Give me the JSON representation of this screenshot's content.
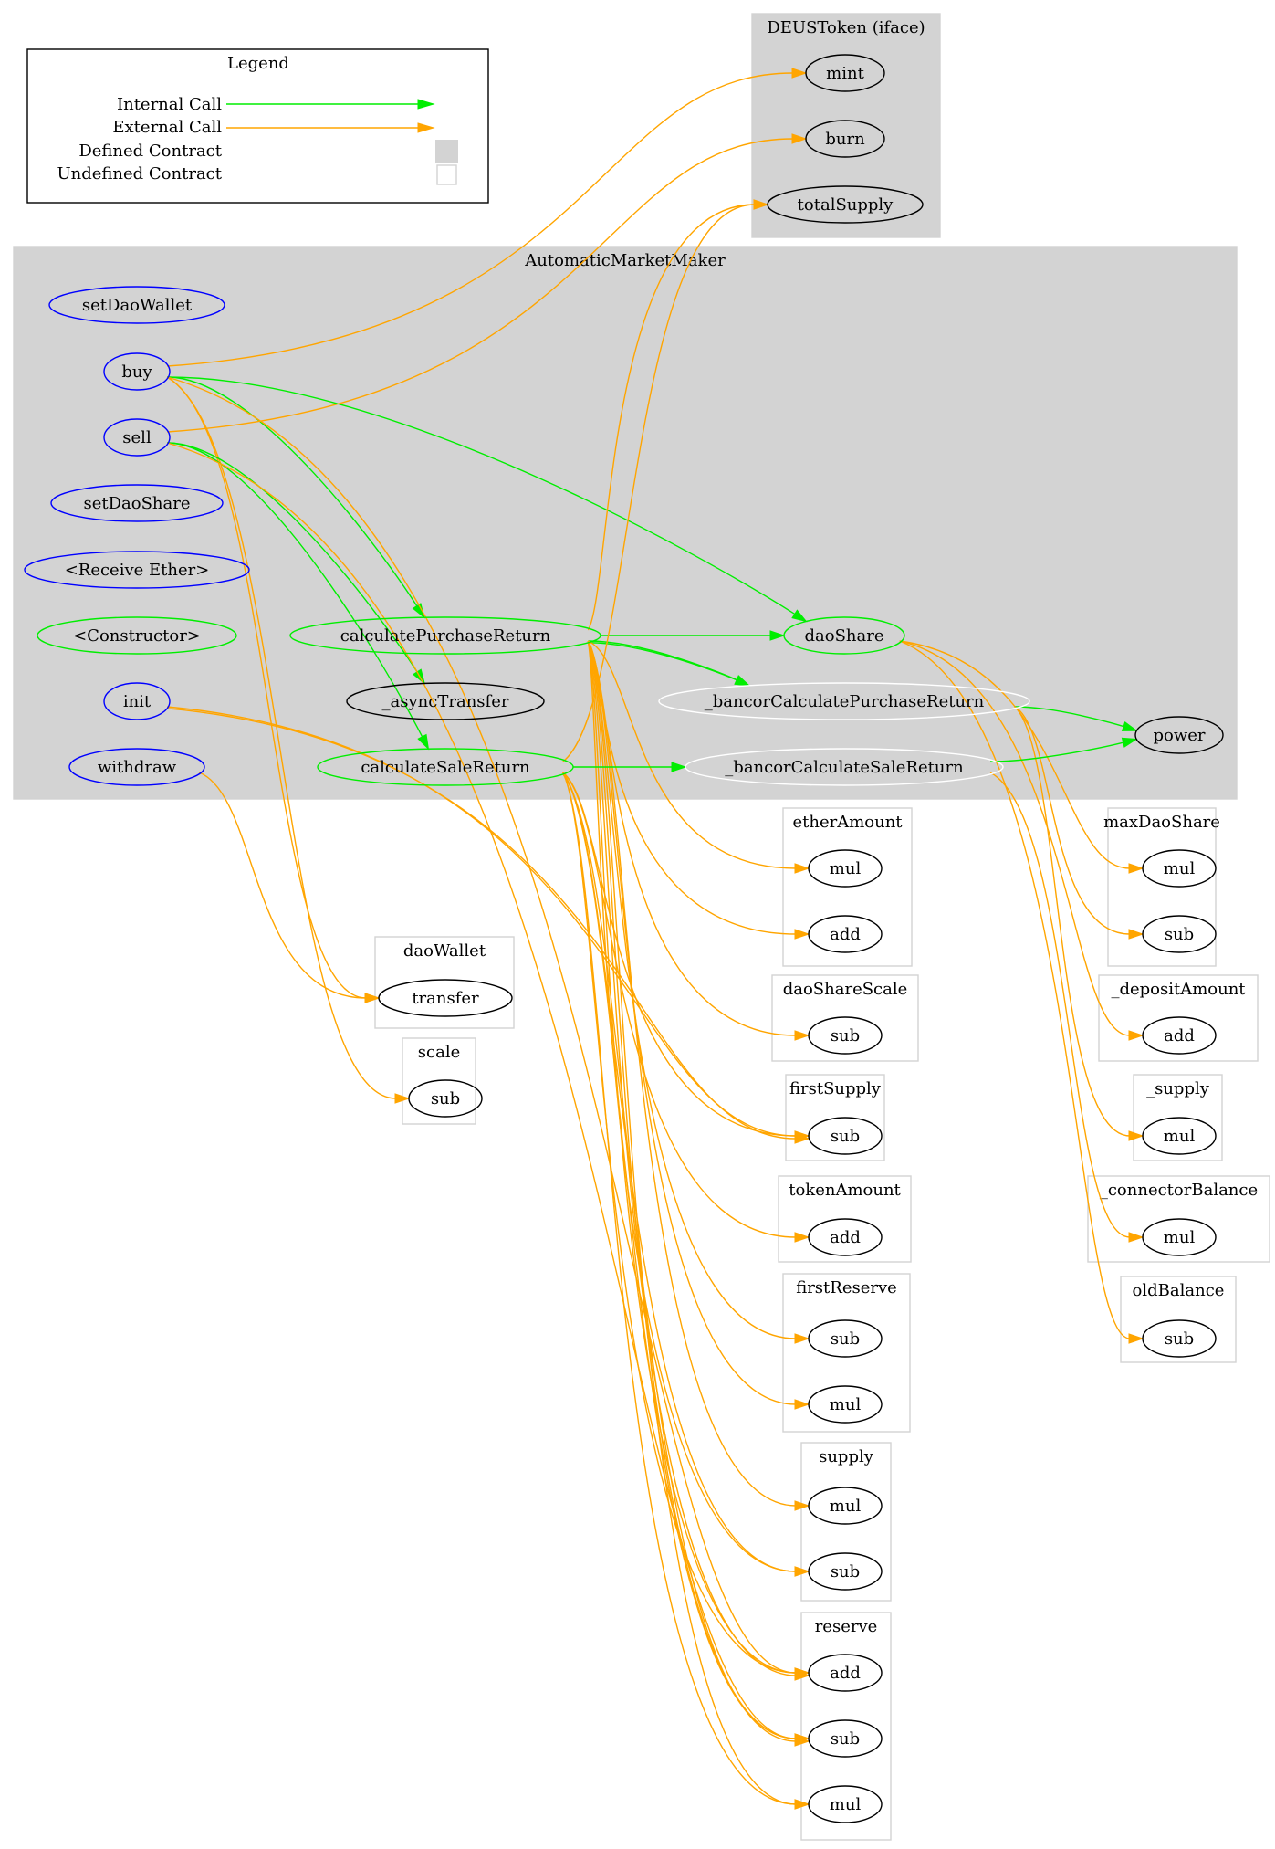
{
  "legend": {
    "title": "Legend",
    "items": [
      {
        "label": "Internal Call",
        "kind": "internal-edge"
      },
      {
        "label": "External Call",
        "kind": "external-edge"
      },
      {
        "label": "Defined Contract",
        "kind": "defined-box"
      },
      {
        "label": "Undefined Contract",
        "kind": "undefined-box"
      }
    ]
  },
  "colors": {
    "internal_call": "#00ee00",
    "external_call": "#ffa500",
    "defined_contract_fill": "#d3d3d3",
    "undefined_contract_border": "#d3d3d3",
    "public_function": "#0000ff",
    "internal_function": "#00ee00",
    "private_function": "#ffffff",
    "external_node": "#000000"
  },
  "clusters": [
    {
      "id": "DEUSToken",
      "label": "DEUSToken  (iface)",
      "defined": true
    },
    {
      "id": "AutomaticMarketMaker",
      "label": "AutomaticMarketMaker",
      "defined": true
    },
    {
      "id": "etherAmount",
      "label": "etherAmount",
      "defined": false
    },
    {
      "id": "maxDaoShare",
      "label": "maxDaoShare",
      "defined": false
    },
    {
      "id": "daoWallet",
      "label": "daoWallet",
      "defined": false
    },
    {
      "id": "daoShareScale",
      "label": "daoShareScale",
      "defined": false
    },
    {
      "id": "_depositAmount",
      "label": "_depositAmount",
      "defined": false
    },
    {
      "id": "scale",
      "label": "scale",
      "defined": false
    },
    {
      "id": "firstSupply",
      "label": "firstSupply",
      "defined": false
    },
    {
      "id": "_supply",
      "label": "_supply",
      "defined": false
    },
    {
      "id": "tokenAmount",
      "label": "tokenAmount",
      "defined": false
    },
    {
      "id": "_connectorBalance",
      "label": "_connectorBalance",
      "defined": false
    },
    {
      "id": "firstReserve",
      "label": "firstReserve",
      "defined": false
    },
    {
      "id": "oldBalance",
      "label": "oldBalance",
      "defined": false
    },
    {
      "id": "supply",
      "label": "supply",
      "defined": false
    },
    {
      "id": "reserve",
      "label": "reserve",
      "defined": false
    }
  ],
  "nodes": [
    {
      "id": "mint",
      "label": "mint",
      "cluster": "DEUSToken",
      "type": "external"
    },
    {
      "id": "burn",
      "label": "burn",
      "cluster": "DEUSToken",
      "type": "external"
    },
    {
      "id": "totalSupply",
      "label": "totalSupply",
      "cluster": "DEUSToken",
      "type": "external"
    },
    {
      "id": "setDaoWallet",
      "label": "setDaoWallet",
      "cluster": "AutomaticMarketMaker",
      "type": "public"
    },
    {
      "id": "buy",
      "label": "buy",
      "cluster": "AutomaticMarketMaker",
      "type": "public"
    },
    {
      "id": "sell",
      "label": "sell",
      "cluster": "AutomaticMarketMaker",
      "type": "public"
    },
    {
      "id": "setDaoShare",
      "label": "setDaoShare",
      "cluster": "AutomaticMarketMaker",
      "type": "public"
    },
    {
      "id": "receiveEther",
      "label": "<Receive Ether>",
      "cluster": "AutomaticMarketMaker",
      "type": "public"
    },
    {
      "id": "constructor",
      "label": "<Constructor>",
      "cluster": "AutomaticMarketMaker",
      "type": "internal"
    },
    {
      "id": "init",
      "label": "init",
      "cluster": "AutomaticMarketMaker",
      "type": "public"
    },
    {
      "id": "withdraw",
      "label": "withdraw",
      "cluster": "AutomaticMarketMaker",
      "type": "public"
    },
    {
      "id": "calculatePurchaseReturn",
      "label": "calculatePurchaseReturn",
      "cluster": "AutomaticMarketMaker",
      "type": "internal"
    },
    {
      "id": "asyncTransfer",
      "label": "_asyncTransfer",
      "cluster": "AutomaticMarketMaker",
      "type": "external"
    },
    {
      "id": "calculateSaleReturn",
      "label": "calculateSaleReturn",
      "cluster": "AutomaticMarketMaker",
      "type": "internal"
    },
    {
      "id": "daoShare",
      "label": "daoShare",
      "cluster": "AutomaticMarketMaker",
      "type": "internal"
    },
    {
      "id": "bancorPurchase",
      "label": "_bancorCalculatePurchaseReturn",
      "cluster": "AutomaticMarketMaker",
      "type": "private"
    },
    {
      "id": "bancorSale",
      "label": "_bancorCalculateSaleReturn",
      "cluster": "AutomaticMarketMaker",
      "type": "private"
    },
    {
      "id": "power",
      "label": "power",
      "cluster": "AutomaticMarketMaker",
      "type": "external"
    },
    {
      "id": "etherAmount_mul",
      "label": "mul",
      "cluster": "etherAmount",
      "type": "external"
    },
    {
      "id": "etherAmount_add",
      "label": "add",
      "cluster": "etherAmount",
      "type": "external"
    },
    {
      "id": "maxDaoShare_mul",
      "label": "mul",
      "cluster": "maxDaoShare",
      "type": "external"
    },
    {
      "id": "maxDaoShare_sub",
      "label": "sub",
      "cluster": "maxDaoShare",
      "type": "external"
    },
    {
      "id": "daoWallet_transfer",
      "label": "transfer",
      "cluster": "daoWallet",
      "type": "external"
    },
    {
      "id": "daoShareScale_sub",
      "label": "sub",
      "cluster": "daoShareScale",
      "type": "external"
    },
    {
      "id": "depositAmount_add",
      "label": "add",
      "cluster": "_depositAmount",
      "type": "external"
    },
    {
      "id": "scale_sub",
      "label": "sub",
      "cluster": "scale",
      "type": "external"
    },
    {
      "id": "firstSupply_sub",
      "label": "sub",
      "cluster": "firstSupply",
      "type": "external"
    },
    {
      "id": "_supply_mul",
      "label": "mul",
      "cluster": "_supply",
      "type": "external"
    },
    {
      "id": "tokenAmount_add",
      "label": "add",
      "cluster": "tokenAmount",
      "type": "external"
    },
    {
      "id": "connectorBalance_mul",
      "label": "mul",
      "cluster": "_connectorBalance",
      "type": "external"
    },
    {
      "id": "firstReserve_sub",
      "label": "sub",
      "cluster": "firstReserve",
      "type": "external"
    },
    {
      "id": "firstReserve_mul",
      "label": "mul",
      "cluster": "firstReserve",
      "type": "external"
    },
    {
      "id": "oldBalance_sub",
      "label": "sub",
      "cluster": "oldBalance",
      "type": "external"
    },
    {
      "id": "supply_mul",
      "label": "mul",
      "cluster": "supply",
      "type": "external"
    },
    {
      "id": "supply_sub",
      "label": "sub",
      "cluster": "supply",
      "type": "external"
    },
    {
      "id": "reserve_add",
      "label": "add",
      "cluster": "reserve",
      "type": "external"
    },
    {
      "id": "reserve_sub",
      "label": "sub",
      "cluster": "reserve",
      "type": "external"
    },
    {
      "id": "reserve_mul",
      "label": "mul",
      "cluster": "reserve",
      "type": "external"
    }
  ],
  "edges": [
    {
      "from": "buy",
      "to": "mint",
      "kind": "external"
    },
    {
      "from": "buy",
      "to": "calculatePurchaseReturn",
      "kind": "internal"
    },
    {
      "from": "buy",
      "to": "daoShare",
      "kind": "internal"
    },
    {
      "from": "buy",
      "to": "daoWallet_transfer",
      "kind": "external"
    },
    {
      "from": "buy",
      "to": "reserve_add",
      "kind": "external"
    },
    {
      "from": "buy",
      "to": "scale_sub",
      "kind": "external"
    },
    {
      "from": "sell",
      "to": "burn",
      "kind": "external"
    },
    {
      "from": "sell",
      "to": "calculateSaleReturn",
      "kind": "internal"
    },
    {
      "from": "sell",
      "to": "asyncTransfer",
      "kind": "internal"
    },
    {
      "from": "sell",
      "to": "reserve_sub",
      "kind": "external"
    },
    {
      "from": "init",
      "to": "firstSupply_sub",
      "kind": "external"
    },
    {
      "from": "init",
      "to": "firstSupply_sub",
      "kind": "external"
    },
    {
      "from": "withdraw",
      "to": "daoWallet_transfer",
      "kind": "external"
    },
    {
      "from": "calculatePurchaseReturn",
      "to": "totalSupply",
      "kind": "external"
    },
    {
      "from": "calculatePurchaseReturn",
      "to": "daoShare",
      "kind": "internal"
    },
    {
      "from": "calculatePurchaseReturn",
      "to": "bancorPurchase",
      "kind": "internal"
    },
    {
      "from": "calculatePurchaseReturn",
      "to": "bancorPurchase",
      "kind": "internal"
    },
    {
      "from": "calculatePurchaseReturn",
      "to": "etherAmount_mul",
      "kind": "external"
    },
    {
      "from": "calculatePurchaseReturn",
      "to": "etherAmount_add",
      "kind": "external"
    },
    {
      "from": "calculatePurchaseReturn",
      "to": "daoShareScale_sub",
      "kind": "external"
    },
    {
      "from": "calculatePurchaseReturn",
      "to": "firstReserve_sub",
      "kind": "external"
    },
    {
      "from": "calculatePurchaseReturn",
      "to": "firstReserve_mul",
      "kind": "external"
    },
    {
      "from": "calculatePurchaseReturn",
      "to": "supply_mul",
      "kind": "external"
    },
    {
      "from": "calculatePurchaseReturn",
      "to": "supply_sub",
      "kind": "external"
    },
    {
      "from": "calculatePurchaseReturn",
      "to": "reserve_add",
      "kind": "external"
    },
    {
      "from": "calculatePurchaseReturn",
      "to": "reserve_add",
      "kind": "external"
    },
    {
      "from": "calculatePurchaseReturn",
      "to": "reserve_sub",
      "kind": "external"
    },
    {
      "from": "calculatePurchaseReturn",
      "to": "reserve_mul",
      "kind": "external"
    },
    {
      "from": "calculateSaleReturn",
      "to": "totalSupply",
      "kind": "external"
    },
    {
      "from": "calculateSaleReturn",
      "to": "bancorSale",
      "kind": "internal"
    },
    {
      "from": "calculateSaleReturn",
      "to": "firstSupply_sub",
      "kind": "external"
    },
    {
      "from": "calculateSaleReturn",
      "to": "tokenAmount_add",
      "kind": "external"
    },
    {
      "from": "calculateSaleReturn",
      "to": "supply_sub",
      "kind": "external"
    },
    {
      "from": "calculateSaleReturn",
      "to": "reserve_sub",
      "kind": "external"
    },
    {
      "from": "calculateSaleReturn",
      "to": "reserve_sub",
      "kind": "external"
    },
    {
      "from": "calculateSaleReturn",
      "to": "reserve_add",
      "kind": "external"
    },
    {
      "from": "calculateSaleReturn",
      "to": "reserve_mul",
      "kind": "external"
    },
    {
      "from": "daoShare",
      "to": "maxDaoShare_mul",
      "kind": "external"
    },
    {
      "from": "daoShare",
      "to": "depositAmount_add",
      "kind": "external"
    },
    {
      "from": "daoShare",
      "to": "oldBalance_sub",
      "kind": "external"
    },
    {
      "from": "bancorPurchase",
      "to": "power",
      "kind": "internal"
    },
    {
      "from": "bancorPurchase",
      "to": "maxDaoShare_sub",
      "kind": "external"
    },
    {
      "from": "bancorPurchase",
      "to": "_supply_mul",
      "kind": "external"
    },
    {
      "from": "bancorSale",
      "to": "power",
      "kind": "internal"
    },
    {
      "from": "bancorSale",
      "to": "connectorBalance_mul",
      "kind": "external"
    }
  ]
}
